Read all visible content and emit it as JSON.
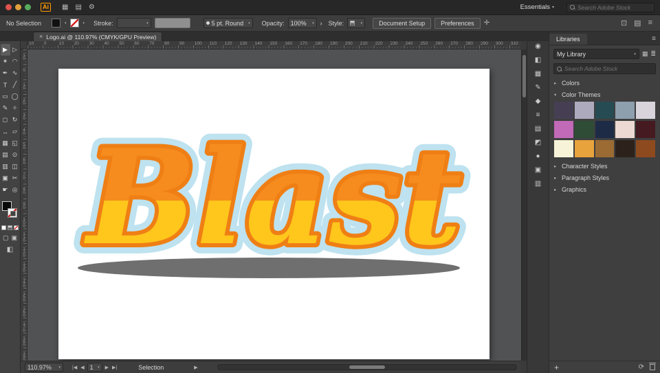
{
  "icons": {
    "chevron_down": "▾",
    "chevron_more": "›",
    "close": "×",
    "menu": "≡",
    "grid_view": "▦",
    "list_view": "≣",
    "plus": "+",
    "sync": "⟳",
    "status_flyout": "▶",
    "brush_dot": "●"
  },
  "app_bar": {
    "traffic_lights": [
      {
        "name": "close-button",
        "color": "#e0524c"
      },
      {
        "name": "minimize-button",
        "color": "#e0a03c"
      },
      {
        "name": "zoom-button",
        "color": "#58ab5c"
      }
    ],
    "logo_text": "Ai",
    "icons": [
      {
        "name": "document-layouts-icon",
        "glyph": "▦"
      },
      {
        "name": "arrange-windows-icon",
        "glyph": "▤"
      },
      {
        "name": "gpu-performance-icon",
        "glyph": "⚙"
      }
    ],
    "workspace_label": "Essentials",
    "stock_search_placeholder": "Search Adobe Stock"
  },
  "control_bar": {
    "selection_status": "No Selection",
    "stroke_label": "Stroke:",
    "brush_label": "5 pt. Round",
    "opacity_label": "Opacity:",
    "opacity_value": "100%",
    "style_label": "Style:",
    "document_setup_label": "Document Setup",
    "preferences_label": "Preferences",
    "right_icons": [
      {
        "name": "zoom-tools-icon",
        "glyph": "⊡"
      },
      {
        "name": "arrange-documents-icon",
        "glyph": "▤"
      },
      {
        "name": "panel-menu-icon",
        "glyph": "≡"
      }
    ]
  },
  "document_tab": {
    "title": "Logo.ai @ 110.97% (CMYK/GPU Preview)"
  },
  "rulers": {
    "horizontal_labels": [
      "10",
      "0",
      "10",
      "20",
      "30",
      "40",
      "50",
      "60",
      "70",
      "80",
      "90",
      "100",
      "110",
      "120",
      "130",
      "140",
      "150",
      "160",
      "170",
      "180",
      "190",
      "200",
      "210",
      "220",
      "230",
      "240",
      "250",
      "260",
      "270",
      "280",
      "290",
      "300",
      "310"
    ],
    "vertical_labels": [
      "10",
      "0",
      "10",
      "20",
      "30",
      "40",
      "50",
      "60",
      "70",
      "80",
      "90",
      "100",
      "110",
      "120",
      "130",
      "140",
      "150",
      "160",
      "170",
      "180",
      "190"
    ]
  },
  "toolbar": {
    "tools": [
      {
        "name": "selection-tool",
        "glyph": "▶"
      },
      {
        "name": "direct-selection-tool",
        "glyph": "▷"
      },
      {
        "name": "magic-wand-tool",
        "glyph": "✶"
      },
      {
        "name": "lasso-tool",
        "glyph": "◠"
      },
      {
        "name": "pen-tool",
        "glyph": "✒"
      },
      {
        "name": "curvature-tool",
        "glyph": "∿"
      },
      {
        "name": "type-tool",
        "glyph": "T"
      },
      {
        "name": "line-segment-tool",
        "glyph": "╱"
      },
      {
        "name": "rectangle-tool",
        "glyph": "▭"
      },
      {
        "name": "ellipse-tool",
        "glyph": "◯"
      },
      {
        "name": "paintbrush-tool",
        "glyph": "✎"
      },
      {
        "name": "pencil-tool",
        "glyph": "✧"
      },
      {
        "name": "eraser-tool",
        "glyph": "◻"
      },
      {
        "name": "rotate-tool",
        "glyph": "↻"
      },
      {
        "name": "width-tool",
        "glyph": "↔"
      },
      {
        "name": "shear-tool",
        "glyph": "▱"
      },
      {
        "name": "free-transform-tool",
        "glyph": "▦"
      },
      {
        "name": "shape-builder-tool",
        "glyph": "◱"
      },
      {
        "name": "gradient-tool",
        "glyph": "▤"
      },
      {
        "name": "blend-tool",
        "glyph": "⊙"
      },
      {
        "name": "column-graph-tool",
        "glyph": "▥"
      },
      {
        "name": "mesh-tool",
        "glyph": "◫"
      },
      {
        "name": "artboard-tool",
        "glyph": "▣"
      },
      {
        "name": "slice-tool",
        "glyph": "✂"
      },
      {
        "name": "hand-tool",
        "glyph": "☛"
      },
      {
        "name": "zoom-tool",
        "glyph": "◎"
      }
    ],
    "draw_normal_glyph": "▢",
    "draw_behind_glyph": "▣",
    "screen_mode_glyph": "◧"
  },
  "artboard": {
    "logo_text": "Blast",
    "logo_colors": {
      "top": "#F68C1E",
      "bottom": "#FFC61C",
      "outline_inner": "#EF7F15",
      "outline_outer": "#BEE2EF",
      "shadow": "#6F6F6F"
    }
  },
  "dock_icons": [
    {
      "name": "color-panel-icon",
      "glyph": "◉"
    },
    {
      "name": "color-guide-panel-icon",
      "glyph": "◧"
    },
    {
      "name": "swatches-panel-icon",
      "glyph": "▦"
    },
    {
      "name": "brushes-panel-icon",
      "glyph": "✎"
    },
    {
      "name": "symbols-panel-icon",
      "glyph": "◆"
    },
    {
      "name": "stroke-panel-icon",
      "glyph": "≡"
    },
    {
      "name": "gradient-panel-icon",
      "glyph": "▤"
    },
    {
      "name": "transparency-panel-icon",
      "glyph": "◩"
    },
    {
      "name": "appearance-panel-icon",
      "glyph": "●"
    },
    {
      "name": "graphic-styles-panel-icon",
      "glyph": "▣"
    },
    {
      "name": "layers-panel-icon",
      "glyph": "▥"
    }
  ],
  "libraries": {
    "panel_title": "Libraries",
    "library_name": "My Library",
    "search_placeholder": "Search Adobe Stock",
    "sections": [
      {
        "arrow": "▸",
        "label": "Colors"
      },
      {
        "arrow": "▾",
        "label": "Color Themes"
      },
      {
        "arrow": "▸",
        "label": "Character Styles"
      },
      {
        "arrow": "▸",
        "label": "Paragraph Styles"
      },
      {
        "arrow": "▸",
        "label": "Graphics"
      }
    ],
    "color_themes": [
      [
        "#463f54",
        "#aeaabe",
        "#274b52",
        "#8e9fae",
        "#d9d4dc"
      ],
      [
        "#c06ab8",
        "#2f4d36",
        "#1d2b47",
        "#ecd9d4",
        "#451a20"
      ],
      [
        "#f7f3d8",
        "#e9a33d",
        "#9c6b33",
        "#2c221b",
        "#8e4a1f"
      ]
    ]
  },
  "status_bar": {
    "zoom": "110.97%",
    "artboard_number": "1",
    "tool_name": "Selection",
    "nav_left": [
      {
        "name": "first-artboard-button",
        "glyph": "|◀"
      },
      {
        "name": "prev-artboard-button",
        "glyph": "◀"
      }
    ],
    "nav_right": [
      {
        "name": "next-artboard-button",
        "glyph": "▶"
      },
      {
        "name": "last-artboard-button",
        "glyph": "▶|"
      }
    ]
  }
}
